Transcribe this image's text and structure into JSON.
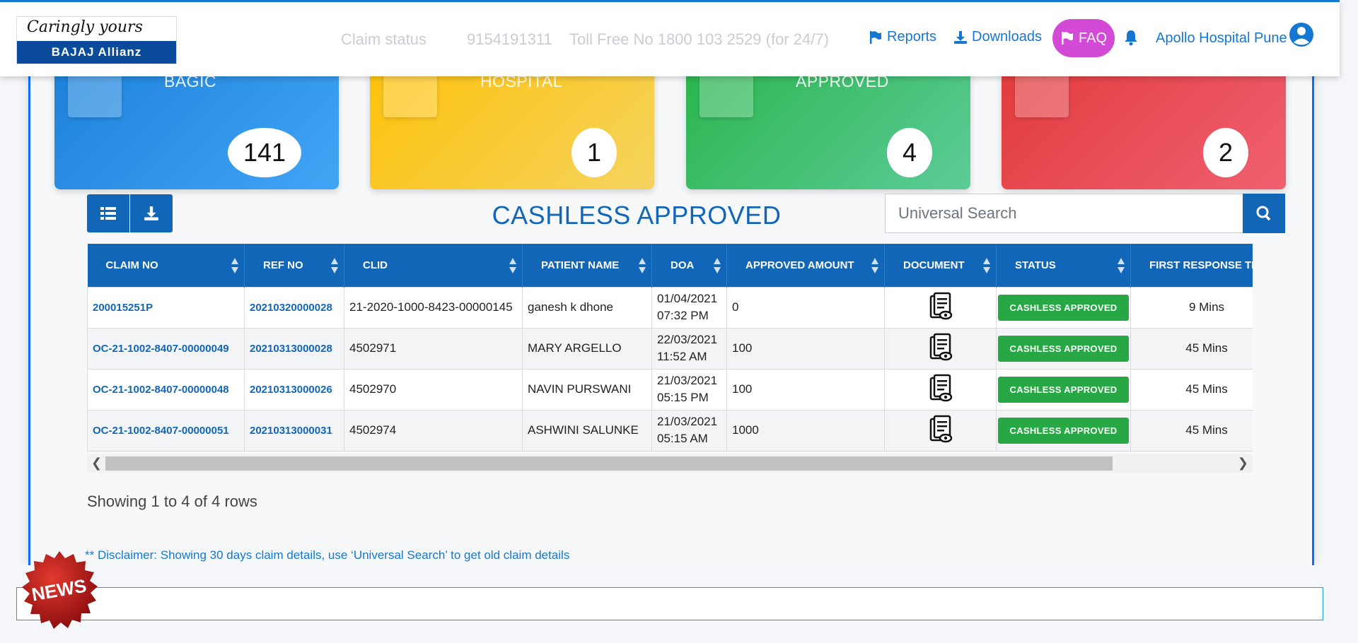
{
  "header": {
    "logo_tagline": "Caringly yours",
    "logo_brand": "BAJAJ Allianz",
    "faded_claim_status": "Claim status",
    "faded_phone": "9154191311",
    "faded_tollfree": "Toll Free No 1800 103 2529 (for 24/7)",
    "reports_label": "Reports",
    "downloads_label": "Downloads",
    "faq_label": "FAQ",
    "user_name": "Apollo Hospital Pune"
  },
  "cards": [
    {
      "label": "BAGIC",
      "count": "141",
      "color_from": "#1a80d9",
      "color_to": "#42a5f5"
    },
    {
      "label": "HOSPITAL",
      "count": "1",
      "color_from": "#ffc107",
      "color_to": "#f4d35e"
    },
    {
      "label": "APPROVED",
      "count": "4",
      "color_from": "#28b44a",
      "color_to": "#5dcc98"
    },
    {
      "label": "",
      "count": "2",
      "color_from": "#e03a3a",
      "color_to": "#f06070"
    }
  ],
  "page": {
    "title": "CASHLESS APPROVED",
    "search_placeholder": "Universal Search"
  },
  "table": {
    "columns": [
      "CLAIM NO",
      "REF NO",
      "CLID",
      "PATIENT NAME",
      "DOA",
      "APPROVED AMOUNT",
      "DOCUMENT",
      "STATUS",
      "FIRST RESPONSE TIME"
    ],
    "rows": [
      {
        "claim_no": "200015251P",
        "ref_no": "20210320000028",
        "clid": "21-2020-1000-8423-00000145",
        "patient": "ganesh k dhone",
        "doa_date": "01/04/2021",
        "doa_time": "07:32 PM",
        "amount": "0",
        "status": "CASHLESS APPROVED",
        "response": "9 Mins"
      },
      {
        "claim_no": "OC-21-1002-8407-00000049",
        "ref_no": "20210313000028",
        "clid": "4502971",
        "patient": "MARY ARGELLO",
        "doa_date": "22/03/2021",
        "doa_time": "11:52 AM",
        "amount": "100",
        "status": "CASHLESS APPROVED",
        "response": "45 Mins"
      },
      {
        "claim_no": "OC-21-1002-8407-00000048",
        "ref_no": "20210313000026",
        "clid": "4502970",
        "patient": "NAVIN PURSWANI",
        "doa_date": "21/03/2021",
        "doa_time": "05:15 PM",
        "amount": "100",
        "status": "CASHLESS APPROVED",
        "response": "45 Mins"
      },
      {
        "claim_no": "OC-21-1002-8407-00000051",
        "ref_no": "20210313000031",
        "clid": "4502974",
        "patient": "ASHWINI SALUNKE",
        "doa_date": "21/03/2021",
        "doa_time": "05:15 AM",
        "amount": "1000",
        "status": "CASHLESS APPROVED",
        "response": "45 Mins"
      }
    ]
  },
  "footer": {
    "showing": "Showing 1 to 4 of 4 rows",
    "disclaimer": "** Disclaimer: Showing 30 days claim details, use ‘Universal Search’ to get old claim details",
    "news_label": "NEWS"
  },
  "icons": {
    "reports": "flag-icon",
    "downloads": "download-icon",
    "faq": "flag-icon",
    "notifications": "bell-icon",
    "user": "user-circle-icon",
    "list": "list-icon",
    "export": "download-icon",
    "search": "search-icon",
    "document": "document-view-icon"
  }
}
